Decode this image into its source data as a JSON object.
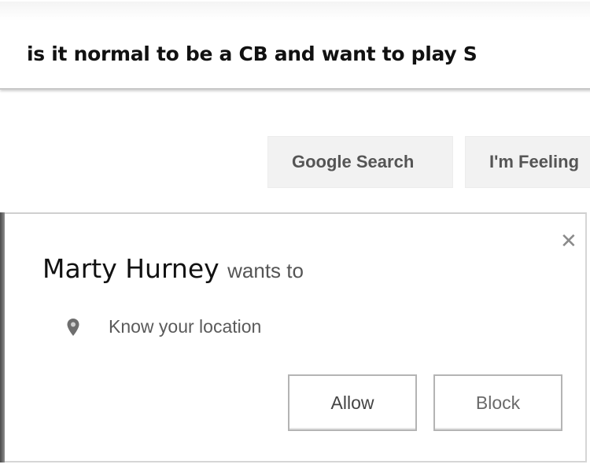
{
  "search": {
    "query": "is it normal to be a CB and want to play S"
  },
  "buttons": {
    "google_search": "Google Search",
    "feeling_lucky": "I'm Feeling"
  },
  "permission_dialog": {
    "requester": "Marty Hurney",
    "wants_to": "wants to",
    "permission": "Know your location",
    "close_symbol": "✕",
    "allow_label": "Allow",
    "block_label": "Block",
    "icons": {
      "close": "close-icon",
      "location": "location-pin-icon"
    }
  },
  "colors": {
    "button_bg": "#f2f2f2",
    "button_text": "#555555",
    "dialog_border": "#d6d6d6"
  }
}
